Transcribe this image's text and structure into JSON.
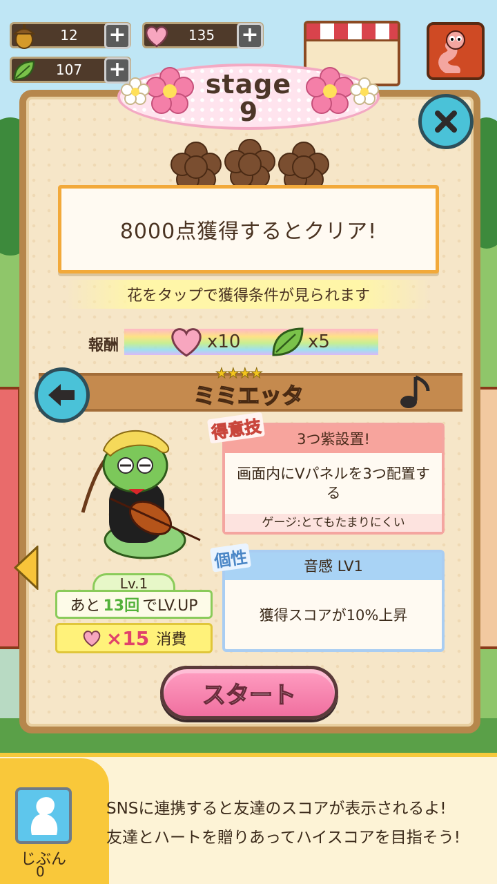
{
  "hud": {
    "acorns": "12",
    "hearts": "135",
    "leaves": "107",
    "plus": "+"
  },
  "stage": {
    "label": "stage",
    "number": "9"
  },
  "goal": {
    "text": "8000点獲得するとクリア!",
    "hint": "花をタップで獲得条件が見られます"
  },
  "reward": {
    "label": "報酬",
    "hearts": "x10",
    "leaves": "x5"
  },
  "character": {
    "stars": "★★★★",
    "rarity": 4,
    "name": "ミミエッタ",
    "level_top": "Lv.1",
    "level_prefix": "あと",
    "level_count": "13回",
    "level_suffix": "でLV.UP",
    "cost_value": "×15",
    "cost_label": "消費"
  },
  "special_skill": {
    "tag": "得意技",
    "title": "3つ紫設置!",
    "description": "画面内にVパネルを3つ配置する",
    "gauge": "ゲージ:とてもたまりにくい"
  },
  "trait": {
    "tag": "個性",
    "title": "音感 LV1",
    "description": "獲得スコアが10%上昇"
  },
  "start_button": "スタート",
  "sns": {
    "self_label": "じぶん",
    "self_score": "0",
    "line1": "SNSに連携すると友達のスコアが表示されるよ!",
    "line2": "友達とハートを贈りあってハイスコアを目指そう!"
  },
  "colors": {
    "panel_bg": "#f6e6c8",
    "panel_border": "#b6874c",
    "goal_border": "#f2a93a",
    "close_button": "#4ac2d8",
    "start_button": "#f06f9f",
    "special_header": "#f7a49d",
    "trait_header": "#a9d3f5"
  },
  "icons": [
    "acorn-icon",
    "heart-icon",
    "leaf-icon",
    "plus-icon",
    "close-icon",
    "back-arrow-icon",
    "music-note-icon",
    "flower-icon"
  ]
}
